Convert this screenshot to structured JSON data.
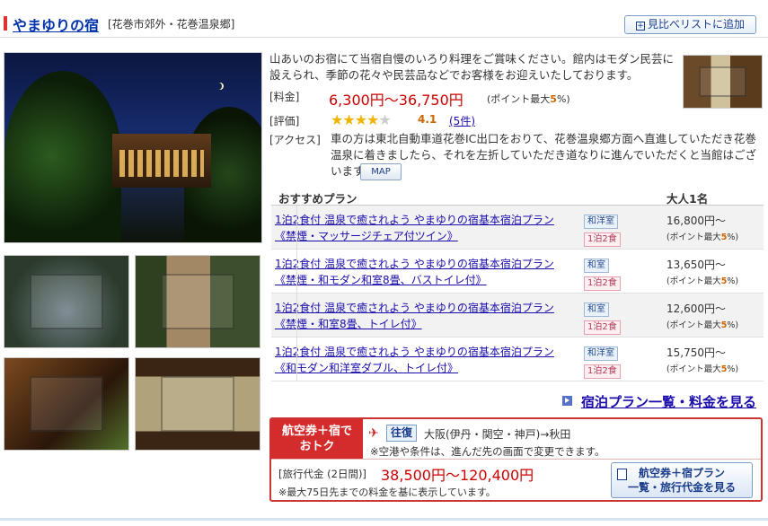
{
  "hotel": {
    "name": "やまゆりの宿",
    "location": "[花巻市郊外・花巻温泉郷]",
    "compare_button": "見比べリストに追加",
    "compare_icon": "plus-box-icon",
    "description": "山あいのお宿にて当宿自慢のいろり料理をご賞味ください。館内はモダン民芸に設えられ、季節の花々や民芸品などでお客様をお迎えいたしております。",
    "price_label": "[料金]",
    "price": "6,300円〜36,750円",
    "price_points": "(ポイント最大",
    "price_points_rate": "5",
    "price_points_suffix": "%)",
    "rating_label": "[評価]",
    "rating_stars": 4,
    "rating_score": "4.1",
    "review_count": "(5件)",
    "access_label": "[アクセス]",
    "access": "車の方は東北自動車道花巻IC出口をおりて、花巻温泉郷方面へ直進していただき花巻温泉に着きましたら、それを左折していただき道なりに進んでいただくと当館はございます。",
    "map_button": "MAP"
  },
  "plans": {
    "header_plan": "おすすめプラン",
    "header_price": "大人1名",
    "items": [
      {
        "name": "1泊2食付 温泉で癒されよう やまゆりの宿基本宿泊プラン《禁煙・マッサージチェア付ツイン》",
        "room": "和洋室",
        "meal": "1泊2食",
        "price": "16,800円〜",
        "points": "(ポイント最大",
        "rate": "5",
        "suffix": "%)"
      },
      {
        "name": "1泊2食付 温泉で癒されよう やまゆりの宿基本宿泊プラン《禁煙・和モダン和室8畳、バストイレ付》",
        "room": "和室",
        "meal": "1泊2食",
        "price": "13,650円〜",
        "points": "(ポイント最大",
        "rate": "5",
        "suffix": "%)"
      },
      {
        "name": "1泊2食付 温泉で癒されよう やまゆりの宿基本宿泊プラン《禁煙・和室8畳、トイレ付》",
        "room": "和室",
        "meal": "1泊2食",
        "price": "12,600円〜",
        "points": "(ポイント最大",
        "rate": "5",
        "suffix": "%)"
      },
      {
        "name": "1泊2食付 温泉で癒されよう やまゆりの宿基本宿泊プラン《和モダン和洋室ダブル、トイレ付》",
        "room": "和洋室",
        "meal": "1泊2食",
        "price": "15,750円〜",
        "points": "(ポイント最大",
        "rate": "5",
        "suffix": "%)"
      }
    ],
    "all_link": "宿泊プラン一覧・料金を見る"
  },
  "air": {
    "badge_line1": "航空券＋宿で",
    "badge_line2": "おトク",
    "round_trip": "往復",
    "route": "大阪(伊丹・関空・神戸)→秋田",
    "note1": "※空港や条件は、進んだ先の画面で変更できます。",
    "fee_label": "[旅行代金 (2日間)]",
    "fee": "38,500円〜120,400円",
    "note2": "※最大75日先までの料金を基に表示しています。",
    "button_line1": "航空券＋宿プラン",
    "button_line2": "一覧・旅行代金を見る"
  }
}
